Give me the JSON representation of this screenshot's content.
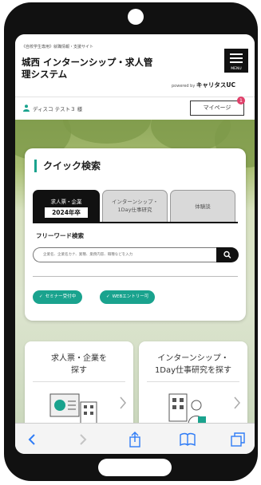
{
  "header": {
    "tagline": "《自校学生専用》就職情報・支援サイト",
    "title_line1": "城西 インターンシップ・求人管",
    "title_line2": "理システム",
    "menu_label": "MENU",
    "powered_by_prefix": "powered by",
    "powered_by_brand": "キャリタスUC"
  },
  "user": {
    "name": "ディスコ テスト３ 様",
    "mypage_label": "マイページ",
    "mypage_badge": "1"
  },
  "quick_search": {
    "title": "クイック検索",
    "tabs": [
      {
        "line1": "求人票・企業",
        "line2": "2024年卒",
        "active": true
      },
      {
        "line1": "インターンシップ・",
        "line2": "1Day仕事研究",
        "active": false
      },
      {
        "line1": "体験談",
        "line2": "",
        "active": false
      }
    ],
    "keyword_label": "フリーワード検索",
    "keyword_placeholder": "企業名、企業名カナ、業種、業務内容、職種などを入力",
    "chips": [
      "セミナー受付中",
      "WEBエントリー可"
    ]
  },
  "tiles": [
    {
      "label_line1": "求人票・企業を",
      "label_line2": "探す"
    },
    {
      "label_line1": "インターンシップ・",
      "label_line2": "1Day仕事研究を探す"
    }
  ],
  "colors": {
    "accent": "#1aa38e",
    "badge": "#e0406a",
    "dark": "#111111"
  },
  "icons": [
    "back-icon",
    "forward-icon",
    "share-icon",
    "bookmarks-icon",
    "tabs-icon",
    "search-icon",
    "person-icon",
    "chevron-right-icon"
  ]
}
